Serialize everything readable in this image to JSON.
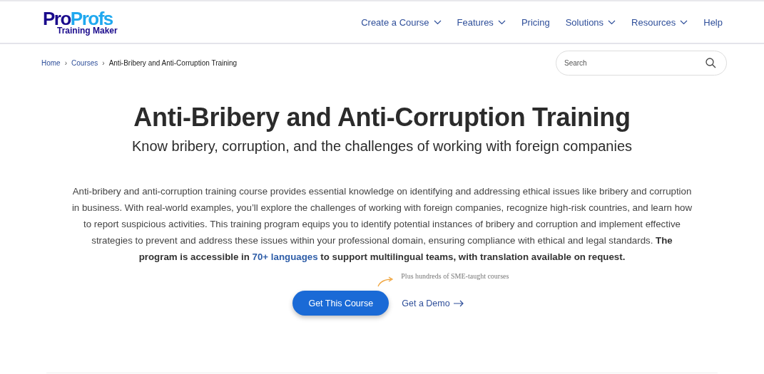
{
  "logo": {
    "brand_a": "Pro",
    "brand_b": "Profs",
    "product": "Training Maker"
  },
  "nav": [
    {
      "label": "Create a Course",
      "dropdown": true
    },
    {
      "label": "Features",
      "dropdown": true
    },
    {
      "label": "Pricing",
      "dropdown": false
    },
    {
      "label": "Solutions",
      "dropdown": true
    },
    {
      "label": "Resources",
      "dropdown": true
    },
    {
      "label": "Help",
      "dropdown": false
    }
  ],
  "breadcrumb": [
    {
      "label": "Home",
      "link": true
    },
    {
      "label": "Courses",
      "link": true
    },
    {
      "label": "Anti-Bribery and Anti-Corruption Training",
      "link": false
    }
  ],
  "breadcrumb_separator": "›",
  "search": {
    "placeholder": "Search"
  },
  "title": "Anti-Bribery and Anti-Corruption Training",
  "subtitle": "Know bribery, corruption, and the challenges of working with foreign companies",
  "description": {
    "text": "Anti-bribery and anti-corruption training course provides essential knowledge on identifying and addressing ethical issues like bribery and corruption in business. With real-world examples, you’ll explore the challenges of working with foreign companies, recognize high-risk countries, and learn how to report suspicious activities. This training program equips you to identify potential instances of bribery and corruption and implement effective strategies to prevent and address these issues within your professional domain, ensuring compliance with ethical and legal standards. ",
    "bold_before": "The program is accessible in ",
    "link": "70+ languages",
    "bold_after": " to support multilingual teams, with translation available on request."
  },
  "note": "Plus hundreds of SME-taught courses",
  "primary_button": "Get This Course",
  "secondary_link": "Get a Demo"
}
